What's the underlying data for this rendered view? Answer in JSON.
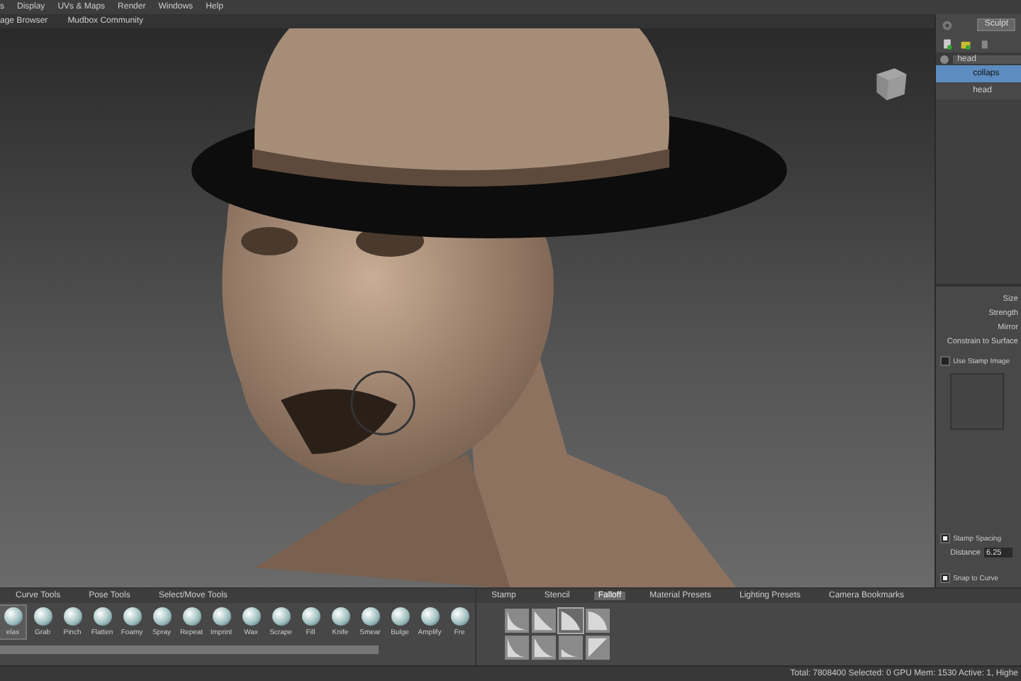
{
  "menu_bar": {
    "items": [
      "s",
      "Display",
      "UVs & Maps",
      "Render",
      "Windows",
      "Help"
    ]
  },
  "tabs": [
    {
      "label": "age Browser",
      "selected": false
    },
    {
      "label": "Mudbox Community",
      "selected": false
    }
  ],
  "right_panel": {
    "mode_button": "Sculpt",
    "layers": {
      "header": "head",
      "rows": [
        {
          "label": "collaps",
          "selected": true
        },
        {
          "label": "head",
          "selected": false
        }
      ]
    },
    "properties": [
      "Size",
      "Strength",
      "Mirror",
      "Constrain to Surface"
    ],
    "use_stamp_image": {
      "label": "Use Stamp Image",
      "checked": false
    },
    "stamp_spacing": {
      "label": "Stamp Spacing",
      "checked": true
    },
    "distance": {
      "label": "Distance",
      "value": "6.25"
    },
    "snap_to_curve": {
      "label": "Snap to Curve",
      "checked": true
    }
  },
  "tool_tray": {
    "tabs": [
      {
        "label": "Curve Tools",
        "selected": false
      },
      {
        "label": "Pose Tools",
        "selected": false
      },
      {
        "label": "Select/Move Tools",
        "selected": false
      }
    ],
    "tools": [
      {
        "label": "elax",
        "selected": true
      },
      {
        "label": "Grab",
        "selected": false
      },
      {
        "label": "Pinch",
        "selected": false
      },
      {
        "label": "Flatten",
        "selected": false
      },
      {
        "label": "Foamy",
        "selected": false
      },
      {
        "label": "Spray",
        "selected": false
      },
      {
        "label": "Repeat",
        "selected": false
      },
      {
        "label": "Imprint",
        "selected": false
      },
      {
        "label": "Wax",
        "selected": false
      },
      {
        "label": "Scrape",
        "selected": false
      },
      {
        "label": "Fill",
        "selected": false
      },
      {
        "label": "Knife",
        "selected": false
      },
      {
        "label": "Smear",
        "selected": false
      },
      {
        "label": "Bulge",
        "selected": false
      },
      {
        "label": "Amplify",
        "selected": false
      },
      {
        "label": "Fre",
        "selected": false
      }
    ]
  },
  "preset_tray": {
    "tabs": [
      {
        "label": "Stamp",
        "selected": false
      },
      {
        "label": "Stencil",
        "selected": false
      },
      {
        "label": "Falloff",
        "selected": true
      },
      {
        "label": "Material Presets",
        "selected": false
      },
      {
        "label": "Lighting Presets",
        "selected": false
      },
      {
        "label": "Camera Bookmarks",
        "selected": false
      }
    ],
    "falloffs": [
      {
        "selected": false
      },
      {
        "selected": false
      },
      {
        "selected": true
      },
      {
        "selected": false
      },
      {
        "selected": false
      },
      {
        "selected": false
      },
      {
        "selected": false
      },
      {
        "selected": false
      }
    ]
  },
  "status_bar": {
    "text": "Total: 7808400  Selected: 0 GPU Mem: 1530  Active: 1, Highe"
  }
}
